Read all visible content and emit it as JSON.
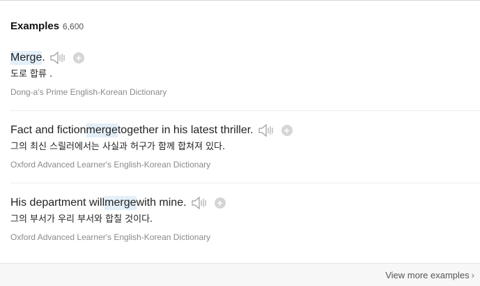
{
  "header": {
    "title": "Examples",
    "count": "6,600"
  },
  "examples": [
    {
      "before": "",
      "highlight": "Merge",
      "after": ".",
      "translation": "도로 합류 .",
      "source": "Dong-a's Prime English-Korean Dictionary"
    },
    {
      "before": "Fact and fiction ",
      "highlight": "merge",
      "after": " together in his latest thriller.",
      "translation": "그의 최신 스릴러에서는 사실과 허구가 함께 합쳐져 있다.",
      "source": "Oxford Advanced Learner's English-Korean Dictionary"
    },
    {
      "before": "His department will ",
      "highlight": "merge",
      "after": " with mine.",
      "translation": "그의 부서가 우리 부서와 합칠 것이다.",
      "source": "Oxford Advanced Learner's English-Korean Dictionary"
    }
  ],
  "icons": {
    "speaker": "speaker-icon",
    "add": "add-icon"
  },
  "plus_symbol": "+",
  "footer": {
    "more_label": "View more examples",
    "chevron": "›"
  },
  "colors": {
    "highlight": "#e3eff9",
    "source_text": "#8a8a8a"
  }
}
